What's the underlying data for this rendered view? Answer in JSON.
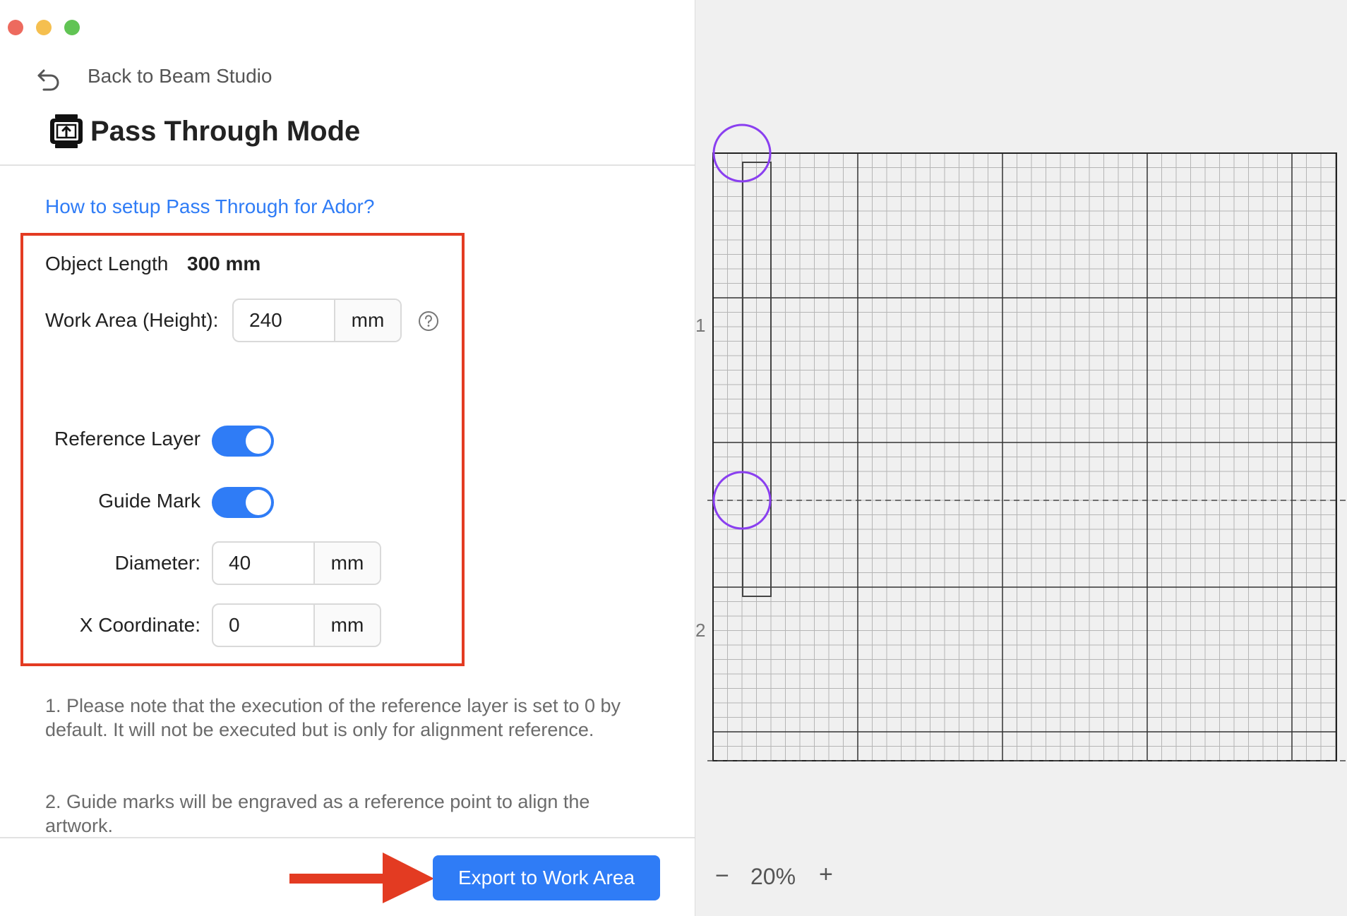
{
  "window": {
    "traffic_lights": {
      "close": "#ed6a5e",
      "minimize": "#f5bf4f",
      "zoom": "#61c454"
    }
  },
  "header": {
    "back_label": "Back to Beam Studio",
    "title": "Pass Through Mode"
  },
  "help_link": "How to setup Pass Through for Ador?",
  "settings": {
    "object_length_label": "Object Length",
    "object_length_value": "300 mm",
    "work_area_label": "Work Area (Height):",
    "work_area_value": "240",
    "work_area_unit": "mm",
    "reference_layer_label": "Reference Layer",
    "reference_layer_on": true,
    "guide_mark_label": "Guide Mark",
    "guide_mark_on": true,
    "diameter_label": "Diameter:",
    "diameter_value": "40",
    "diameter_unit": "mm",
    "x_coord_label": "X Coordinate:",
    "x_coord_value": "0",
    "x_coord_unit": "mm"
  },
  "notes": {
    "note1": "1. Please note that the execution of the reference layer is set to 0 by default. It will not be executed but is only for alignment reference.",
    "note2": "2. Guide marks will be engraved as a reference point to align the artwork."
  },
  "footer": {
    "export_label": "Export to Work Area"
  },
  "canvas": {
    "ruler_labels": [
      "1",
      "2"
    ],
    "zoom_minus": "−",
    "zoom_value": "20%",
    "zoom_plus": "+"
  },
  "colors": {
    "accent": "#2f7cf6",
    "highlight_box": "#e33b22",
    "guide_circle": "#8a3ff0",
    "grid_minor": "#b5b5b5",
    "grid_major": "#333333"
  }
}
